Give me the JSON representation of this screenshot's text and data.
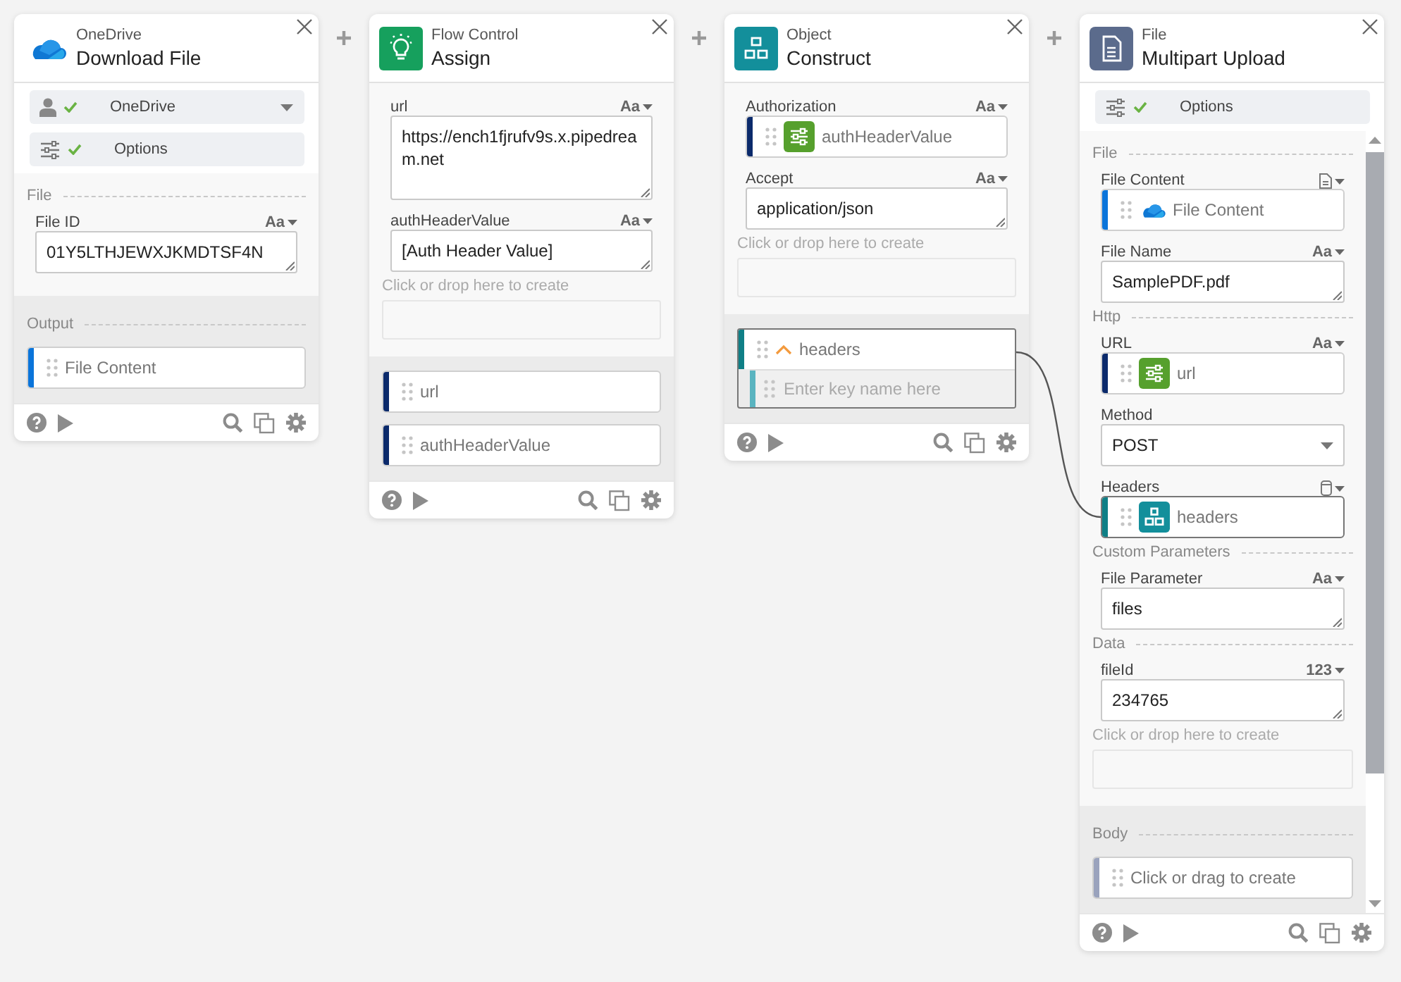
{
  "cards": [
    {
      "category": "OneDrive",
      "title": "Download File",
      "connections": [
        {
          "kind": "account",
          "label": "OneDrive",
          "ok": true,
          "dropdown": true
        },
        {
          "kind": "options",
          "label": "Options",
          "ok": true,
          "dropdown": false
        }
      ],
      "body": [
        {
          "kind": "group",
          "label": "File"
        },
        {
          "kind": "field",
          "label": "File ID",
          "type_label": "Aa",
          "value": {
            "kind": "text",
            "text": "01Y5LTHJEWXJKMDTSF4N"
          }
        }
      ],
      "output": [
        {
          "kind": "group",
          "label": "Output"
        },
        {
          "kind": "token",
          "label": "File Content",
          "color": "#0a74da",
          "highlighted": false
        }
      ]
    },
    {
      "category": "Flow Control",
      "title": "Assign",
      "body": [
        {
          "kind": "field",
          "label": "url",
          "type_label": "Aa",
          "value": {
            "kind": "text",
            "text": "https://ench1fjrufv9s.x.pipedream.net",
            "tall": true
          }
        },
        {
          "kind": "field",
          "label": "authHeaderValue",
          "type_label": "Aa",
          "value": {
            "kind": "text",
            "text": "[Auth Header Value]",
            "tall": false
          }
        },
        {
          "kind": "drop",
          "label": "Click or drop here to create"
        }
      ],
      "output": [
        {
          "kind": "token",
          "label": "url",
          "color": "#0b2a6b",
          "highlighted": false
        },
        {
          "kind": "token",
          "label": "authHeaderValue",
          "color": "#0b2a6b",
          "highlighted": false
        }
      ]
    },
    {
      "category": "Object",
      "title": "Construct",
      "body": [
        {
          "kind": "field",
          "label": "Authorization",
          "type_label": "Aa",
          "value": {
            "kind": "setting_token",
            "label": "authHeaderValue",
            "color": "#0b2a6b",
            "highlighted": false
          }
        },
        {
          "kind": "field",
          "label": "Accept",
          "type_label": "Aa",
          "value": {
            "kind": "text",
            "text": "application/json"
          }
        },
        {
          "kind": "drop",
          "label": "Click or drop here to create"
        }
      ],
      "output": [
        {
          "kind": "token",
          "label": "headers",
          "color": "#0f7f86",
          "highlighted": true,
          "expanded": true,
          "key_placeholder": "Enter key name here"
        }
      ]
    },
    {
      "category": "File",
      "title": "Multipart Upload",
      "scrollable": true,
      "connections": [
        {
          "kind": "options",
          "label": "Options",
          "ok": true,
          "dropdown": false
        }
      ],
      "body": [
        {
          "kind": "group",
          "label": "File"
        },
        {
          "kind": "file_field",
          "label": "File Content",
          "value": {
            "kind": "cloud_token",
            "label": "File Content",
            "color": "#0a74da",
            "highlighted": false
          }
        },
        {
          "kind": "field",
          "label": "File Name",
          "type_label": "Aa",
          "value": {
            "kind": "text",
            "text": "SamplePDF.pdf"
          }
        },
        {
          "kind": "group",
          "label": "Http"
        },
        {
          "kind": "field",
          "label": "URL",
          "type_label": "Aa",
          "value": {
            "kind": "setting_token",
            "label": "url",
            "color": "#0b2a6b",
            "highlighted": false
          }
        },
        {
          "kind": "field",
          "label": "Method",
          "value": {
            "kind": "select",
            "text": "POST"
          }
        },
        {
          "kind": "list_field",
          "label": "Headers",
          "value": {
            "kind": "object_token",
            "label": "headers",
            "color": "#0f7f86",
            "highlighted": true
          }
        },
        {
          "kind": "group",
          "label": "Custom Parameters"
        },
        {
          "kind": "field",
          "label": "File Parameter",
          "type_label": "Aa",
          "value": {
            "kind": "text",
            "text": "files"
          }
        },
        {
          "kind": "group",
          "label": "Data"
        },
        {
          "kind": "field",
          "label": "fileId",
          "type_label": "123",
          "value": {
            "kind": "text",
            "text": "234765"
          }
        },
        {
          "kind": "drop",
          "label": "Click or drop here to create"
        }
      ],
      "output": [
        {
          "kind": "group",
          "label": "Body"
        },
        {
          "kind": "token",
          "label": "Click or drag to create",
          "color": "#9aa3bd",
          "highlighted": false
        }
      ]
    }
  ]
}
